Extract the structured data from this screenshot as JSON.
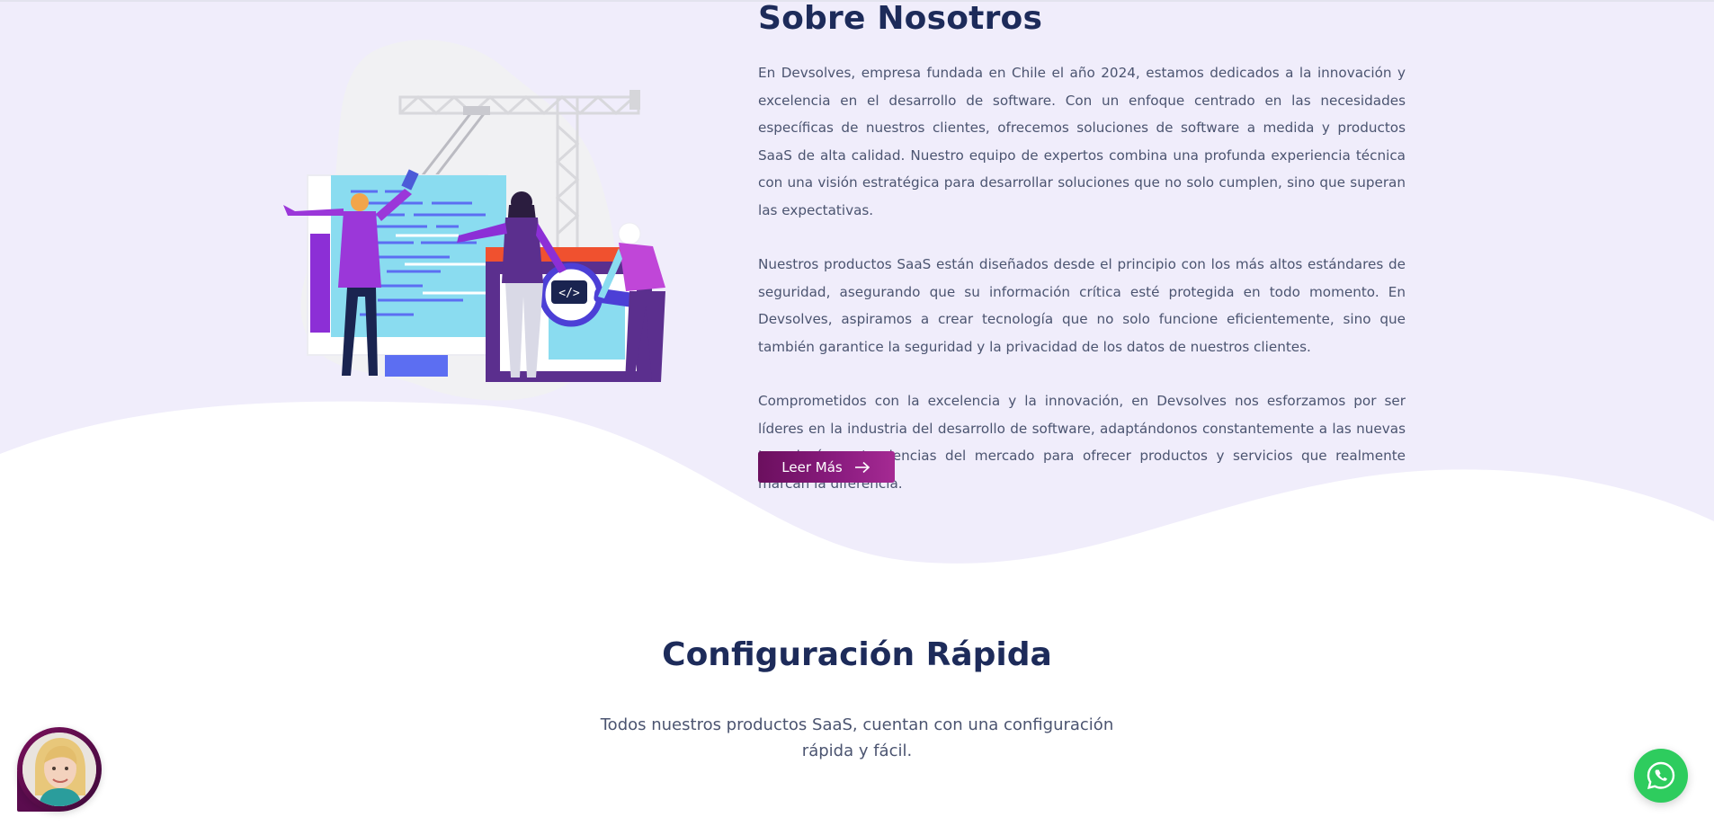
{
  "about": {
    "title": "Sobre Nosotros",
    "paragraphs": [
      "En Devsolves, empresa fundada en Chile el año 2024, estamos dedicados a la innovación y excelencia en el desarrollo de software. Con un enfoque centrado en las necesidades específicas de nuestros clientes, ofrecemos soluciones de software a medida y productos SaaS de alta calidad. Nuestro equipo de expertos combina una profunda experiencia técnica con una visión estratégica para desarrollar soluciones que no solo cumplen, sino que superan las expectativas.",
      "Nuestros productos SaaS están diseñados desde el principio con los más altos estándares de seguridad, asegurando que su información crítica esté protegida en todo momento. En Devsolves, aspiramos a crear tecnología que no solo funcione eficientemente, sino que también garantice la seguridad y la privacidad de los datos de nuestros clientes.",
      "Comprometidos con la excelencia y la innovación, en Devsolves nos esforzamos por ser líderes en la industria del desarrollo de software, adaptándonos constantemente a las nuevas tecnologías y tendencias del mercado para ofrecer productos y servicios que realmente marcan la diferencia."
    ],
    "button_label": "Leer Más",
    "button_icon": "arrow-right-icon"
  },
  "config": {
    "title": "Configuración Rápida",
    "subtitle": "Todos nuestros productos SaaS, cuentan con una configuración rápida y fácil."
  },
  "widgets": {
    "chat_avatar": "avatar",
    "whatsapp_icon": "whatsapp-icon"
  },
  "colors": {
    "section_bg": "#f0edfb",
    "heading": "#1d2b5a",
    "body_text": "#4b5470",
    "button_gradient_start": "#6b0f5e",
    "button_gradient_end": "#a52a93",
    "whatsapp": "#2ecc5e"
  }
}
